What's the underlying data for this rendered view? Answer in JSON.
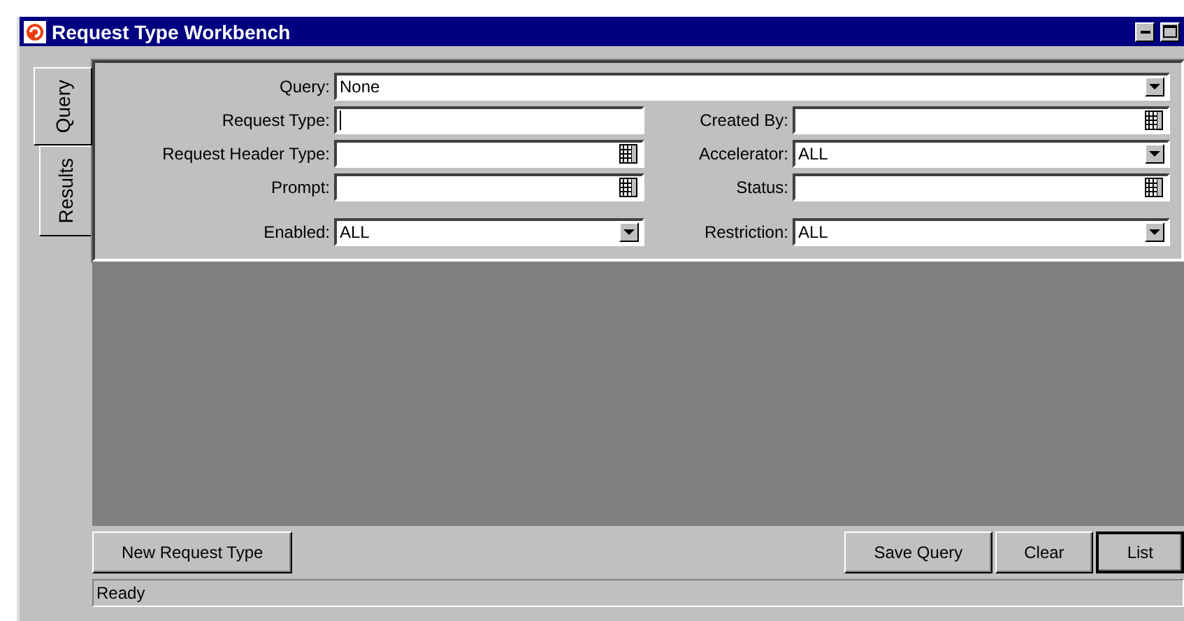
{
  "window": {
    "title": "Request Type Workbench"
  },
  "tabs": [
    {
      "label": "Query",
      "selected": true
    },
    {
      "label": "Results",
      "selected": false
    }
  ],
  "query": {
    "label": "Query:",
    "value": "None",
    "kind": "dropdown",
    "focused": false
  },
  "rows": [
    [
      {
        "label": "Request Type:",
        "kind": "text",
        "focused": true
      },
      {
        "label": "Created By:",
        "kind": "lookup",
        "focused": false
      }
    ],
    [
      {
        "label": "Request Header Type:",
        "kind": "lookup",
        "focused": false
      },
      {
        "label": "Accelerator:",
        "value": "ALL",
        "kind": "dropdown",
        "focused": false
      }
    ],
    [
      {
        "label": "Prompt:",
        "kind": "lookup",
        "focused": false
      },
      {
        "label": "Status:",
        "kind": "lookup",
        "focused": false
      }
    ],
    [
      {
        "label": "Enabled:",
        "value": "ALL",
        "kind": "dropdown",
        "focused": false
      },
      {
        "label": "Restriction:",
        "value": "ALL",
        "kind": "dropdown",
        "focused": false
      }
    ]
  ],
  "left_buttons": [
    {
      "label": "New Request Type",
      "default": false
    }
  ],
  "right_buttons": [
    {
      "label": "Save Query",
      "default": false
    },
    {
      "label": "Clear",
      "default": false
    },
    {
      "label": "List",
      "default": true
    }
  ],
  "status_bar": {
    "text": "Ready"
  }
}
